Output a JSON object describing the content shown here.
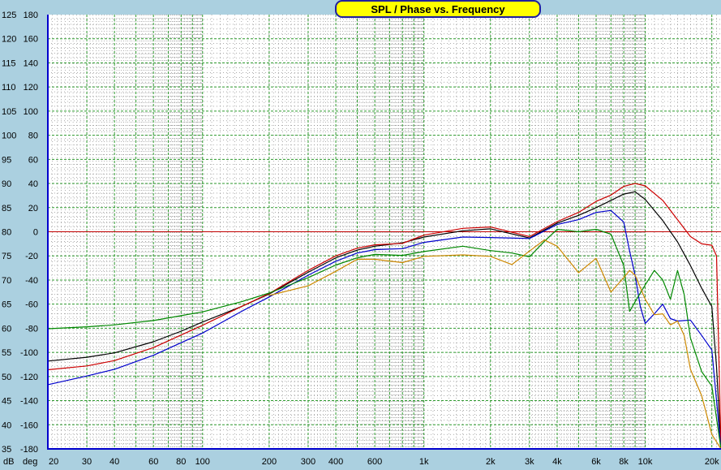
{
  "window": {
    "title": "SPL / Phase vs. Frequency"
  },
  "colors": {
    "background": "#abd0e0",
    "plot_area": "#ffffff",
    "grid": "#2e9a2e",
    "axis": "#0000cc",
    "reference_line": "#c00000",
    "title_fill": "#ffff00",
    "title_border": "#1f1f9f"
  },
  "chart_data": {
    "type": "line",
    "title": "SPL / Phase vs. Frequency",
    "xscale": "log",
    "xlim": [
      20,
      22000
    ],
    "ylim": [
      35,
      125
    ],
    "y2lim": [
      -180,
      180
    ],
    "ylabel": "dB",
    "y2label": "deg",
    "grid": true,
    "reference_line_db": 80,
    "x_ticks": [
      {
        "v": 20,
        "label": "20"
      },
      {
        "v": 30,
        "label": "30"
      },
      {
        "v": 40,
        "label": "40"
      },
      {
        "v": 60,
        "label": "60"
      },
      {
        "v": 80,
        "label": "80"
      },
      {
        "v": 100,
        "label": "100"
      },
      {
        "v": 200,
        "label": "200"
      },
      {
        "v": 300,
        "label": "300"
      },
      {
        "v": 400,
        "label": "400"
      },
      {
        "v": 600,
        "label": "600"
      },
      {
        "v": 1000,
        "label": "1k"
      },
      {
        "v": 2000,
        "label": "2k"
      },
      {
        "v": 3000,
        "label": "3k"
      },
      {
        "v": 4000,
        "label": "4k"
      },
      {
        "v": 6000,
        "label": "6k"
      },
      {
        "v": 8000,
        "label": "8k"
      },
      {
        "v": 10000,
        "label": "10k"
      },
      {
        "v": 20000,
        "label": "20k"
      }
    ],
    "y_ticks_db": [
      "125",
      "120",
      "115",
      "110",
      "105",
      "100",
      "95",
      "90",
      "85",
      "80",
      "75",
      "70",
      "65",
      "60",
      "55",
      "50",
      "45",
      "40",
      "35"
    ],
    "y_ticks_deg": [
      "180",
      "160",
      "140",
      "120",
      "100",
      "80",
      "60",
      "40",
      "20",
      "0",
      "-20",
      "-40",
      "-60",
      "-80",
      "-100",
      "-120",
      "-140",
      "-160",
      "-180"
    ],
    "series": [
      {
        "color": "#000000",
        "x": [
          20,
          30,
          40,
          60,
          80,
          100,
          150,
          200,
          300,
          400,
          500,
          600,
          800,
          1000,
          1500,
          2000,
          3000,
          4000,
          5000,
          6000,
          7000,
          8000,
          9000,
          10000,
          12000,
          14000,
          16000,
          18000,
          20000,
          21000,
          22000
        ],
        "y": [
          53.2,
          54,
          54.9,
          57.2,
          59.4,
          61.3,
          64.5,
          67.1,
          71.6,
          74.6,
          76.2,
          77,
          77.7,
          78.9,
          80.2,
          80.6,
          78.7,
          81.8,
          83.4,
          85,
          86.5,
          87.8,
          88.3,
          86.7,
          82.3,
          77.9,
          73,
          68.3,
          64.5,
          52,
          35
        ]
      },
      {
        "color": "#cc0000",
        "x": [
          20,
          30,
          40,
          60,
          80,
          100,
          150,
          200,
          300,
          400,
          500,
          600,
          800,
          1000,
          1500,
          2000,
          3000,
          4000,
          5000,
          6000,
          7000,
          8000,
          9000,
          10000,
          12000,
          14000,
          16000,
          18000,
          20000,
          21000,
          22000
        ],
        "y": [
          51.4,
          52.2,
          53.3,
          56,
          58.6,
          60.6,
          64.5,
          67.2,
          72,
          75,
          76.6,
          77.3,
          77.6,
          79.3,
          80.7,
          81,
          79,
          82.1,
          84,
          86.3,
          87.6,
          89.4,
          90,
          89.5,
          86.5,
          82.5,
          79,
          77.5,
          77.2,
          75,
          35
        ]
      },
      {
        "color": "#0000cc",
        "x": [
          20,
          30,
          40,
          60,
          80,
          100,
          150,
          200,
          300,
          400,
          500,
          600,
          800,
          1000,
          1500,
          2000,
          3000,
          4000,
          5000,
          6000,
          7000,
          8000,
          8500,
          9000,
          9500,
          10000,
          11000,
          12000,
          13000,
          14000,
          16000,
          18000,
          20000,
          22000
        ],
        "y": [
          48.3,
          50.1,
          51.5,
          54.4,
          57,
          59,
          63.5,
          66.5,
          71,
          73.9,
          75.6,
          76.3,
          76.5,
          77.8,
          78.9,
          78.8,
          78.6,
          81.5,
          82.5,
          84,
          84.4,
          82,
          76,
          71,
          64.5,
          61,
          63,
          65,
          62,
          61.5,
          61.7,
          58.5,
          55.5,
          35
        ]
      },
      {
        "color": "#008800",
        "x": [
          20,
          30,
          40,
          60,
          80,
          100,
          150,
          200,
          300,
          400,
          500,
          600,
          800,
          1000,
          1500,
          2000,
          2500,
          3000,
          3500,
          4000,
          5000,
          6000,
          7000,
          8000,
          8500,
          9000,
          10000,
          11000,
          12000,
          13000,
          14000,
          15000,
          16000,
          18000,
          20000,
          22000
        ],
        "y": [
          59.9,
          60.3,
          60.7,
          61.6,
          62.6,
          63.4,
          65.5,
          67.3,
          70.5,
          73.1,
          74.6,
          75.3,
          75.1,
          75.9,
          77,
          76.1,
          75.6,
          74.8,
          78,
          80.5,
          80,
          80.5,
          79.5,
          73,
          63.5,
          65.5,
          69,
          72,
          70,
          66,
          72,
          67,
          58,
          51,
          48,
          35
        ]
      },
      {
        "color": "#cc8800",
        "x": [
          20,
          30,
          40,
          60,
          80,
          100,
          150,
          200,
          300,
          400,
          500,
          600,
          800,
          1000,
          1500,
          2000,
          2500,
          3000,
          3500,
          4000,
          5000,
          6000,
          7000,
          8000,
          8500,
          9000,
          10000,
          11000,
          12000,
          13000,
          14000,
          15000,
          16000,
          18000,
          20000,
          22000
        ],
        "y": [
          null,
          null,
          null,
          null,
          null,
          null,
          null,
          66.8,
          68.8,
          71.8,
          74.3,
          74.3,
          73.6,
          74.9,
          75.2,
          74.9,
          73.2,
          76,
          78.3,
          77,
          71.5,
          74.5,
          67.5,
          70.5,
          72,
          71,
          66,
          62.8,
          63,
          60.7,
          61.5,
          58.5,
          51.5,
          46,
          38,
          35
        ]
      }
    ]
  }
}
